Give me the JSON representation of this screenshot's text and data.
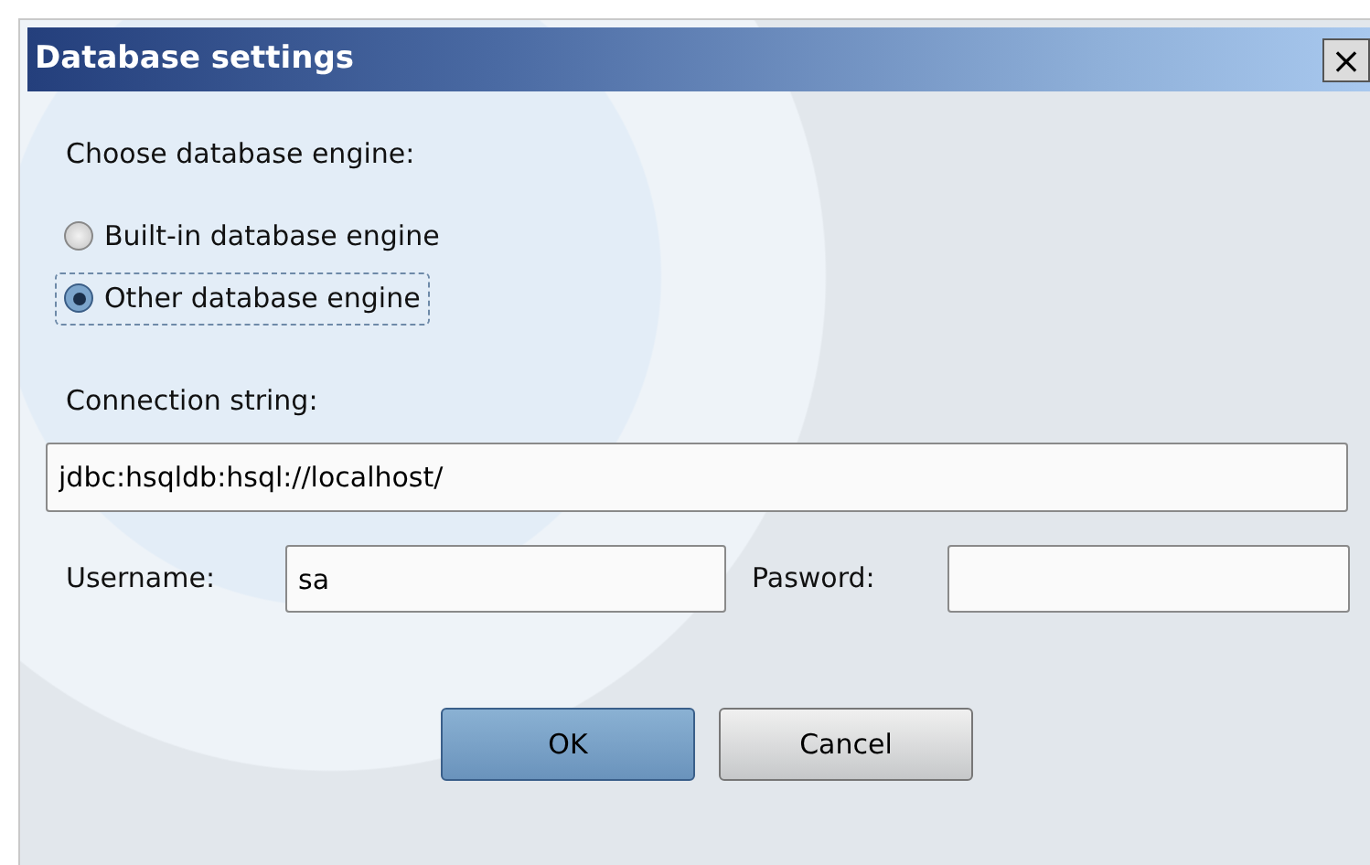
{
  "window": {
    "title": "Database settings",
    "close": "×"
  },
  "engine": {
    "label": "Choose database engine:",
    "options": [
      {
        "label": "Built-in database engine",
        "selected": false
      },
      {
        "label": "Other database engine",
        "selected": true
      }
    ]
  },
  "connection": {
    "label": "Connection string:",
    "value": "jdbc:hsqldb:hsql://localhost/"
  },
  "username": {
    "label": "Username:",
    "value": "sa"
  },
  "password": {
    "label": "Pasword:"
  },
  "buttons": [
    {
      "label": "OK",
      "kind": "primary"
    },
    {
      "label": "Cancel",
      "kind": "secondary"
    }
  ]
}
